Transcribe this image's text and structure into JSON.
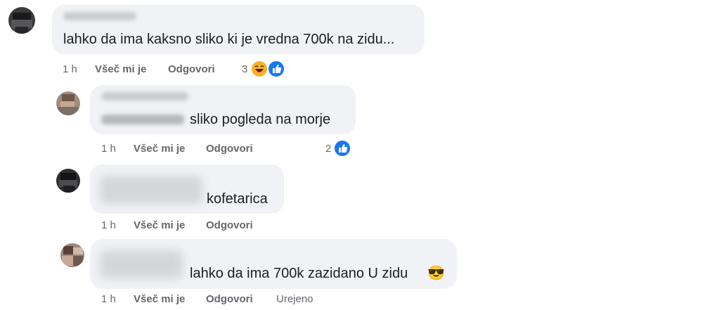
{
  "comments": [
    {
      "text": "lahko da ima kaksno sliko ki je vredna 700k na zidu...",
      "time": "1 h",
      "like_label": "Všeč mi je",
      "reply_label": "Odgovori",
      "reaction_count": "3",
      "reactions": [
        "haha-icon",
        "like-icon"
      ]
    },
    {
      "text": "sliko pogleda na morje",
      "time": "1 h",
      "like_label": "Všeč mi je",
      "reply_label": "Odgovori",
      "reaction_count": "2",
      "reactions": [
        "like-icon"
      ]
    },
    {
      "text": "kofetarica",
      "time": "1 h",
      "like_label": "Všeč mi je",
      "reply_label": "Odgovori"
    },
    {
      "text": "lahko da ima 700k zazidano U zidu",
      "emoji": "😎",
      "time": "1 h",
      "like_label": "Všeč mi je",
      "reply_label": "Odgovori",
      "edited_label": "Urejeno"
    }
  ],
  "colors": {
    "bubble": "#f0f2f5",
    "meta": "#65676b",
    "like_blue": "#1877f2",
    "haha_yellow": "#f7b125"
  }
}
